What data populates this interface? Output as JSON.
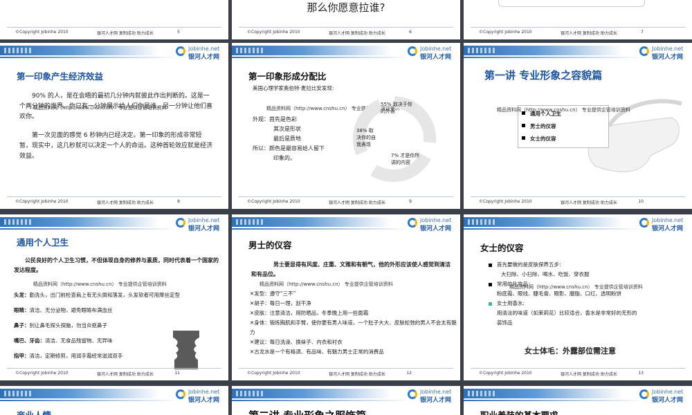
{
  "footer": {
    "copyright": "©Copyright  Jobinhe  2010",
    "slogan": "银河人才网    复制成功    助力成长"
  },
  "logo": {
    "en": "Jobinhe.net",
    "cn": "银河人才网"
  },
  "watermark": "精品资料网（http://www.cnshu.cn） 专业提供企管培训资料",
  "row0": {
    "s5": {
      "page": "5"
    },
    "s6": {
      "page": "6",
      "text": "那么你愿意拉谁?"
    },
    "s7": {
      "page": "7"
    }
  },
  "s8": {
    "page": "8",
    "title": "第一印象产生经济效益",
    "p1": "90% 的人，是在会晤的最初几分钟内就彼此作出判断的。这是一个两分钟的世界。你只有一分钟展示给人们你是谁，另一分钟让他们喜欢你。",
    "p2": "第一次见面的感觉 6 秒钟内已经决定。第一印象的形成非常短暂，现实中，这几秒就可以决定一个人的命运。这种首轮效应就是经济效益。"
  },
  "s9": {
    "page": "9",
    "title": "第一印象形成分配比",
    "intro": "美国心理学家奥伯特·麦拉比安发现:",
    "l1": "外观：首先是色彩",
    "l2": "其次是形状",
    "l3": "最后是质地",
    "l4": "所以：颜色是最容易给人留下",
    "l5": "印象的。",
    "pie1": "55% 取决于你的外表",
    "pie2": "38% 取决你的自我表现",
    "pie3": "7% 才是你所讲的内容"
  },
  "s10": {
    "page": "10",
    "title": "第一讲  专业形象之容貌篇",
    "items": [
      "通用个人卫生",
      "男士的仪容",
      "女士的仪容"
    ]
  },
  "s11": {
    "page": "11",
    "title": "通用个人卫生",
    "intro": "公民良好的个人卫生习惯，不但体现自身的修养与素质，同时代表着一个国家的发达程度。",
    "rows": [
      {
        "k": "头发：",
        "v": "勤洗头，出门前检查肩上有无头屑和落发，头发软者可用摩丝定型"
      },
      {
        "k": "眼睛：",
        "v": "清洁、无分泌物，避免眼睛布满血丝"
      },
      {
        "k": "鼻子：",
        "v": "别让鼻毛探头探脑，勿当众抠鼻子"
      },
      {
        "k": "嘴巴、牙齿：",
        "v": "清洁、无食品残留物、无异味"
      },
      {
        "k": "指甲：",
        "v": "清洁，定期修剪，用润手霜经常滋润双手"
      }
    ]
  },
  "s12": {
    "page": "12",
    "title": "男士的仪容",
    "intro": "男士要显得有风度、庄重、文雅和有朝气，他的外形应该使人感觉到清洁和有品位。",
    "rows": [
      "发型：遵守“三不”",
      "胡子：每日一理，刮干净",
      "皮肤：注意清洁，用防晒品，冬季晚上用一些面霜",
      "身体：锻炼胸肌和手臂，使你更有男人味道，一个肚子大大、皮肤松弛的男人不会太有魅力",
      "建议：每日洗澡、换袜子、内衣和衬衣",
      "古龙水是一个有格调、有品味、有魅力男士正常的消费品"
    ]
  },
  "s13": {
    "page": "13",
    "title": "女士的仪容",
    "b1": "首先要做的是皮肤保养五步:",
    "b1a": "大扫除、小扫除、喝水、吃饭、穿衣服",
    "b2": "常用的化妆品：",
    "b2a": "粉底霜、眼线、睫毛膏、眼影、胭脂、口红、透明粉饼",
    "b3": "女士用香水:",
    "b3a": "用清淡的味道（如茉莉花）比较适合，香水是非常好的无形的",
    "b3b": "装饰品",
    "bold": "女士体毛：外露部位需注意"
  },
  "row4": {
    "a": "商业人情",
    "b": "第二讲  专业形象之服饰篇",
    "c": "职业着装的基本要求"
  }
}
